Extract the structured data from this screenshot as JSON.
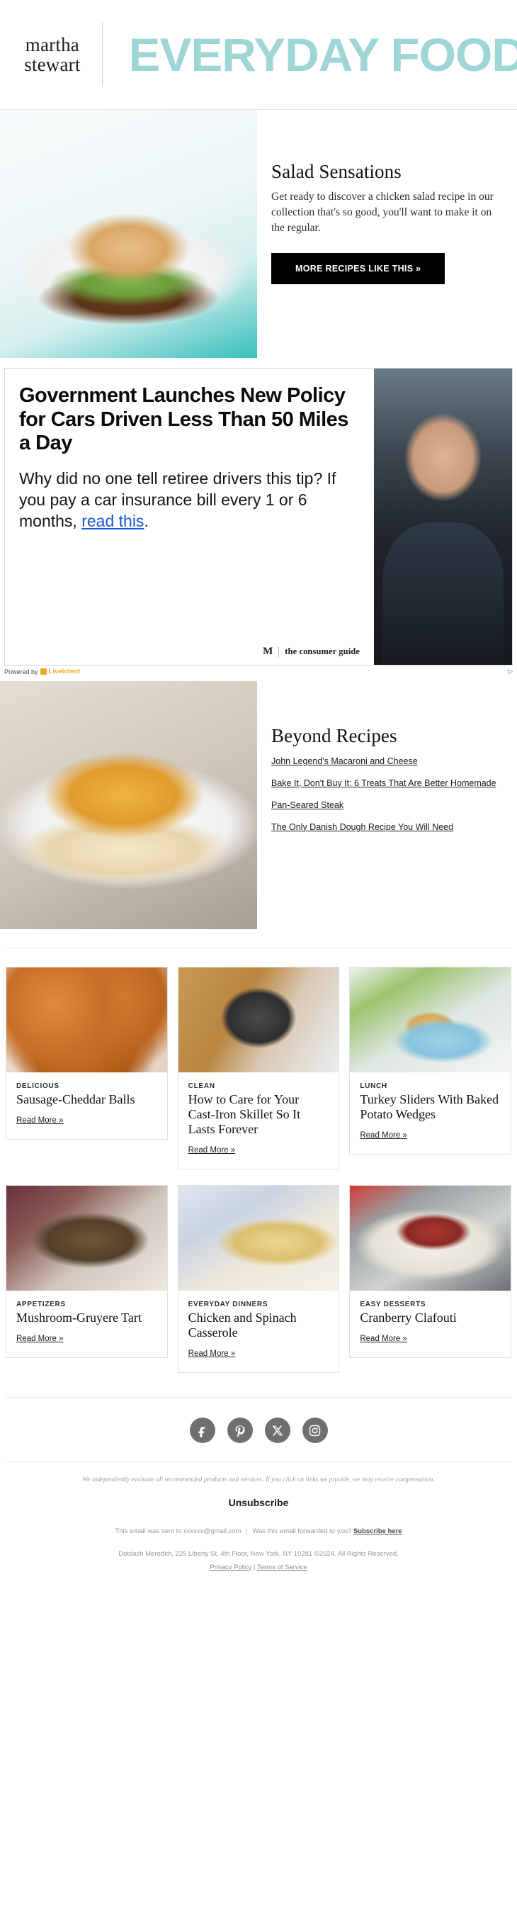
{
  "header": {
    "brand_logo_line1": "martha",
    "brand_logo_line2": "stewart",
    "newsletter_title": "EVERYDAY FOOD",
    "accent_color": "#9ed5d5"
  },
  "hero": {
    "image_alt": "chicken-salad-open-face-sandwich",
    "title": "Salad Sensations",
    "body": "Get ready to discover a chicken salad recipe in our collection that's so good, you'll want to make it on the regular.",
    "cta_label": "MORE RECIPES LIKE THIS »"
  },
  "ad": {
    "headline": "Government Launches New Policy for Cars Driven Less Than 50 Miles a Day",
    "body_before_link": "Why did no one tell retiree drivers this tip? If you pay a car insurance bill every 1 or 6 months, ",
    "link_text": "read this",
    "body_after_link": ".",
    "advertiser_name": "the consumer guide",
    "advertiser_mark": "M",
    "image_alt": "police-officer-photo",
    "powered_by_prefix": "Powered by",
    "powered_by_name": "LiveIntent",
    "adchoices_label": "AdChoices"
  },
  "beyond": {
    "image_alt": "baked-noodle-kugel-slice",
    "title": "Beyond Recipes",
    "links": [
      "John Legend's Macaroni and Cheese",
      "Bake It, Don't Buy It: 6 Treats That Are Better Homemade",
      "Pan-Seared Steak",
      "The Only Danish Dough Recipe You Will Need"
    ]
  },
  "cards": {
    "read_more_label": "Read More »",
    "row1": [
      {
        "eyebrow": "DELICIOUS",
        "title": "Sausage-Cheddar Balls",
        "image_alt": "sausage-cheddar-balls-photo",
        "photo_class": "ph-sausage"
      },
      {
        "eyebrow": "CLEAN",
        "title": "How to Care for Your Cast-Iron Skillet So It Lasts Forever",
        "image_alt": "cast-iron-skillet-photo",
        "photo_class": "ph-skillet"
      },
      {
        "eyebrow": "LUNCH",
        "title": "Turkey Sliders With Baked Potato Wedges",
        "image_alt": "turkey-sliders-photo",
        "photo_class": "ph-slider"
      }
    ],
    "row2": [
      {
        "eyebrow": "APPETIZERS",
        "title": "Mushroom-Gruyere Tart",
        "image_alt": "mushroom-gruyere-tart-photo",
        "photo_class": "ph-tart"
      },
      {
        "eyebrow": "EVERYDAY DINNERS",
        "title": "Chicken and Spinach Casserole",
        "image_alt": "chicken-spinach-casserole-photo",
        "photo_class": "ph-casserole"
      },
      {
        "eyebrow": "EASY DESSERTS",
        "title": "Cranberry Clafouti",
        "image_alt": "cranberry-clafouti-photo",
        "photo_class": "ph-clafouti"
      }
    ]
  },
  "footer": {
    "social": [
      {
        "name": "facebook-icon",
        "glyph": "f"
      },
      {
        "name": "pinterest-icon",
        "glyph": "P"
      },
      {
        "name": "x-twitter-icon",
        "glyph": "X"
      },
      {
        "name": "instagram-icon",
        "glyph": "O"
      }
    ],
    "disclaimer": "We independently evaluate all recommended products and services. If you click on links we provide, we may receive compensation.",
    "unsubscribe_label": "Unsubscribe",
    "sent_to_text": "This email was sent to xxxxxx@gmail.com",
    "separator": "|",
    "forwarded_text": "Was this email forwarded to you?",
    "subscribe_link": "Subscribe here",
    "address": "Dotdash Meredith, 225 Liberty St, 4th Floor, New York, NY 10281 ©2024. All Rights Reserved.",
    "privacy_link": "Privacy Policy",
    "terms_link": "Terms of Service"
  }
}
